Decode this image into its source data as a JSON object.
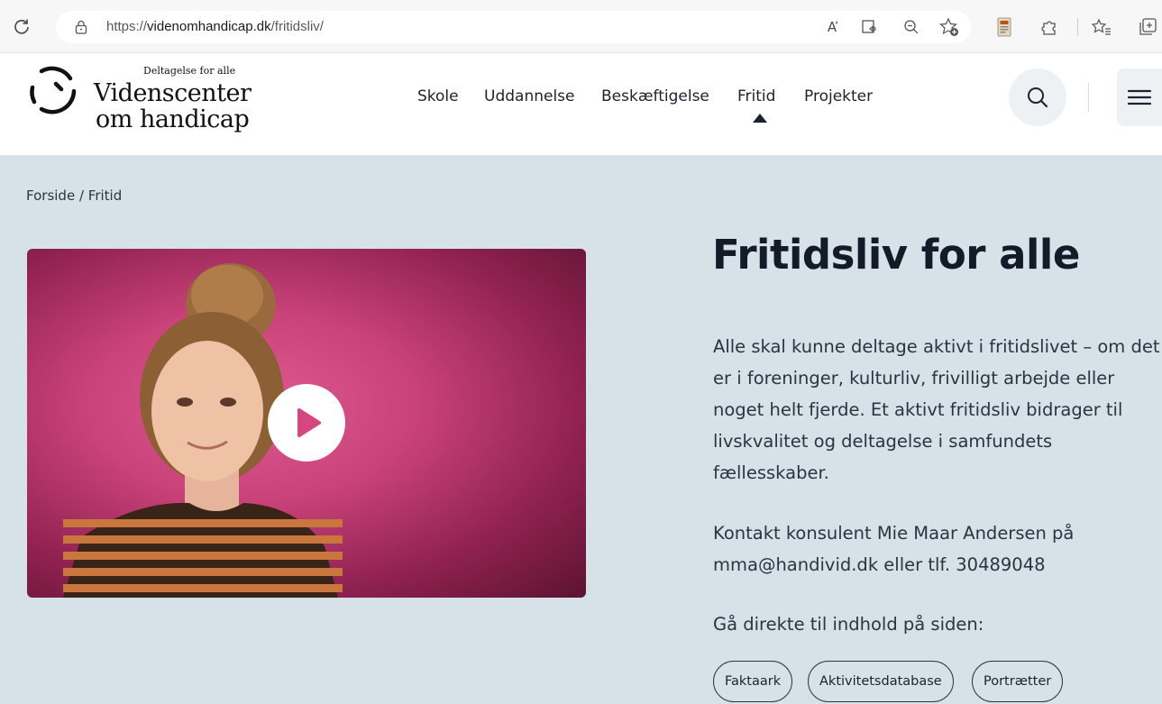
{
  "browser": {
    "url_prefix": "https://",
    "url_domain": "videnomhandicap.dk",
    "url_path": "/fritidsliv/",
    "read_aloud_label": "A̕",
    "icons": [
      "reload-icon",
      "lock-icon",
      "read-aloud-icon",
      "immersive-reader-icon",
      "zoom-out-icon",
      "add-favorite-icon",
      "extension-icon",
      "puzzle-icon",
      "favorites-icon",
      "collections-icon"
    ]
  },
  "header": {
    "logo_tagline": "Deltagelse for alle",
    "logo_line1": "Videnscenter",
    "logo_line2": "om handicap",
    "nav": [
      {
        "label": "Skole"
      },
      {
        "label": "Uddannelse"
      },
      {
        "label": "Beskæftigelse"
      },
      {
        "label": "Fritid",
        "active": true
      },
      {
        "label": "Projekter"
      }
    ]
  },
  "breadcrumb": {
    "home": "Forside",
    "separator": "/",
    "current": "Fritid"
  },
  "main": {
    "title": "Fritidsliv for alle",
    "intro": "Alle skal kunne deltage aktivt i fritidslivet – om det er i foreninger, kulturliv, frivilligt arbejde eller noget helt fjerde. Et aktivt fritidsliv bidrager til livskvalitet og deltagelse i samfundets fællesskaber.",
    "contact": "Kontakt konsulent Mie Maar Andersen på mma@handivid.dk eller tlf. 30489048",
    "jump_label": "Gå direkte til indhold på siden:",
    "chips": [
      "Faktaark",
      "Aktivitetsdatabase",
      "Portrætter"
    ]
  },
  "colors": {
    "page_bg": "#d7e1e8",
    "text": "#1b2330",
    "video_pink": "#c94279"
  }
}
